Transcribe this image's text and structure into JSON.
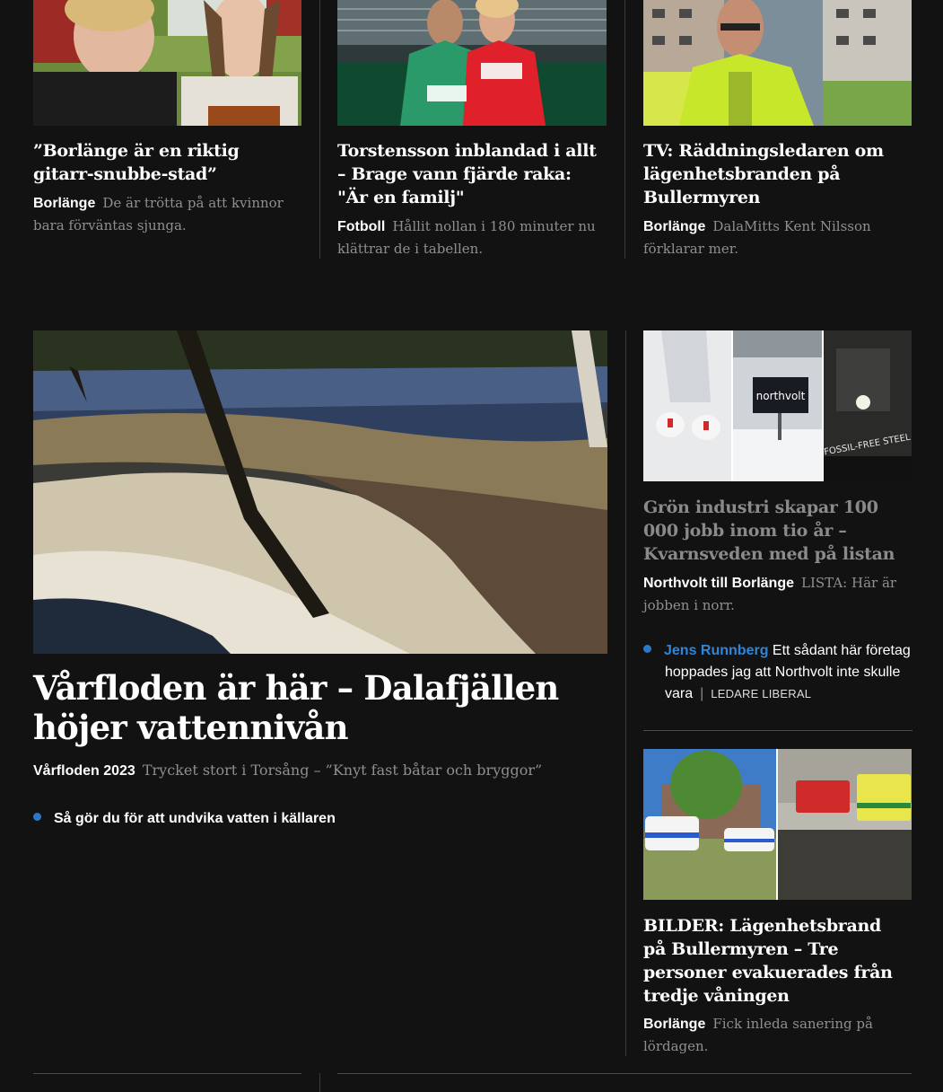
{
  "top_row": [
    {
      "headline": "”Borlänge är en riktig gitarr-snubbe-stad”",
      "category": "Borlänge",
      "lead": "De är trötta på att kvinnor bara förväntas sjunga.",
      "image_icon": "photo-two-women-laughing"
    },
    {
      "headline": "Torstensson inblandad i allt – Brage vann fjärde raka: \"Är en familj\"",
      "category": "Fotboll",
      "lead": "Hållit nollan i 180 minuter nu klättrar de i tabellen.",
      "image_icon": "photo-football-players"
    },
    {
      "headline": "TV: Räddningsledaren om lägenhetsbranden på Bullermyren",
      "category": "Borlänge",
      "lead": "DalaMitts Kent Nilsson förklarar mer.",
      "image_icon": "photo-rescue-leader"
    }
  ],
  "main_story": {
    "headline": "Vårfloden är här – Dalafjällen höjer vattennivån",
    "category": "Vårfloden 2023",
    "lead": "Trycket stort i Torsång – ”Knyt fast båtar och bryggor”",
    "related_link": "Så gör du för att undvika vatten i källaren",
    "image_icon": "photo-spring-flood-river"
  },
  "side_story_1": {
    "headline": "Grön industri skapar 100 000 jobb inom tio år – Kvarnsveden med på listan",
    "category": "Northvolt till Borlänge",
    "lead": "LISTA: Här är jobben i norr.",
    "image_icon": "photo-collage-industry",
    "sign_text": "northvolt",
    "sign_text_2": "FOSSIL-FREE STEEL",
    "opinion": {
      "author": "Jens Runnberg",
      "text": "Ett sådant här företag hoppades jag att Northvolt inte skulle vara",
      "tag": "LEDARE LIBERAL"
    }
  },
  "side_story_2": {
    "headline": "BILDER: Lägenhetsbrand på Bullermyren – Tre personer evakuerades från tredje våningen",
    "category": "Borlänge",
    "lead": "Fick inleda sanering på lördagen.",
    "image_icon": "photo-emergency-vehicles"
  },
  "colors": {
    "background": "#121212",
    "accent_blue": "#2a78c8",
    "divider": "#3a3a3a"
  }
}
